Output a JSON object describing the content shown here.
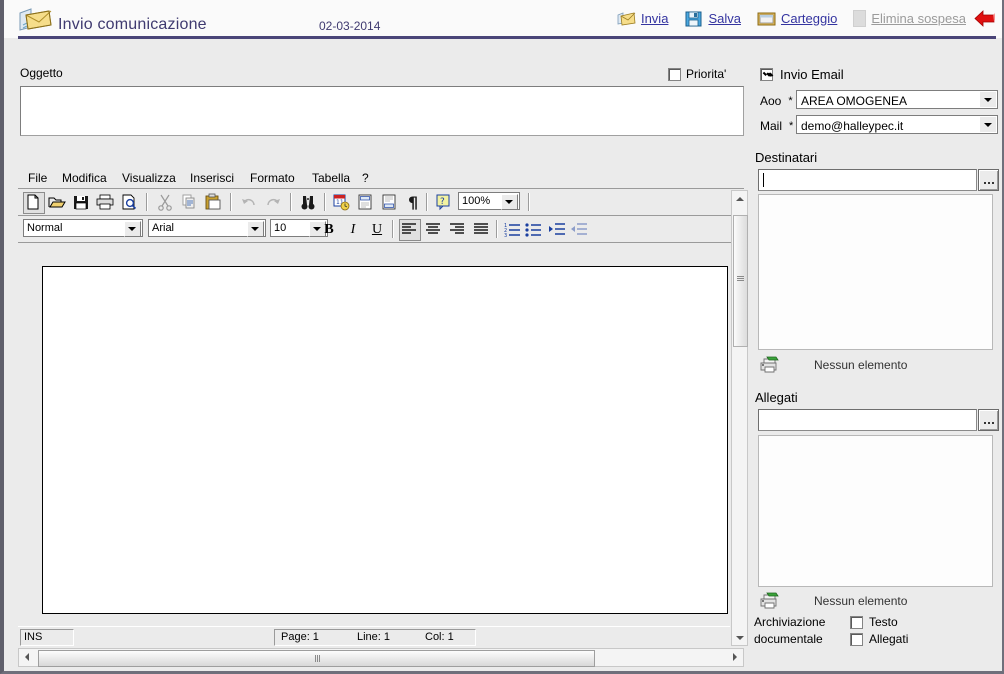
{
  "header": {
    "title": "Invio comunicazione",
    "date": "02-03-2014",
    "icon": "envelopes-icon",
    "actions": [
      {
        "label": "Invia",
        "icon": "send-mail-icon",
        "disabled": false
      },
      {
        "label": "Salva",
        "icon": "floppy-disk-icon",
        "disabled": false
      },
      {
        "label": "Carteggio",
        "icon": "folder-window-icon",
        "disabled": false
      },
      {
        "label": "Elimina sospesa",
        "icon": "delete-icon",
        "disabled": true
      }
    ],
    "back_icon": "red-back-arrow-icon"
  },
  "subject": {
    "label": "Oggetto",
    "value": "",
    "priority_label": "Priorita'",
    "priority_checked": false
  },
  "editor": {
    "menu": [
      "File",
      "Modifica",
      "Visualizza",
      "Inserisci",
      "Formato",
      "Tabella",
      "?"
    ],
    "toolbar1": [
      {
        "name": "new-document-icon",
        "glyph": "new"
      },
      {
        "name": "open-folder-icon",
        "glyph": "open"
      },
      {
        "name": "save-floppy-icon",
        "glyph": "save"
      },
      {
        "name": "print-icon",
        "glyph": "print"
      },
      {
        "name": "print-preview-icon",
        "glyph": "preview"
      },
      {
        "name": "cut-scissors-icon",
        "glyph": "cut"
      },
      {
        "name": "copy-icon",
        "glyph": "copy"
      },
      {
        "name": "paste-clipboard-icon",
        "glyph": "paste"
      },
      {
        "name": "undo-icon",
        "glyph": "undo"
      },
      {
        "name": "redo-icon",
        "glyph": "redo"
      },
      {
        "name": "find-binoculars-icon",
        "glyph": "find"
      },
      {
        "name": "insert-date-icon",
        "glyph": "date"
      },
      {
        "name": "header-icon",
        "glyph": "header"
      },
      {
        "name": "footer-icon",
        "glyph": "footer"
      },
      {
        "name": "paragraph-marks-icon",
        "glyph": "pilcrow"
      },
      {
        "name": "help-icon",
        "glyph": "help"
      }
    ],
    "zoom_value": "100%",
    "style_value": "Normal",
    "font_value": "Arial",
    "size_value": "10",
    "format_buttons": [
      "B",
      "I",
      "U"
    ],
    "align_icons": [
      "align-left-icon",
      "align-center-icon",
      "align-right-icon",
      "align-justify-icon"
    ],
    "list_icons": [
      "numbered-list-icon",
      "bullet-list-icon",
      "increase-indent-icon",
      "decrease-indent-icon"
    ],
    "body_text": "",
    "status": {
      "mode": "INS",
      "page": "Page: 1",
      "line": "Line: 1",
      "col": "Col: 1"
    }
  },
  "right_panel": {
    "invio_email_label": "Invio Email",
    "invio_email_checked": true,
    "aoo": {
      "label": "Aoo",
      "required": "*",
      "value": "AREA OMOGENEA"
    },
    "mail": {
      "label": "Mail",
      "required": "*",
      "value": "demo@halleypec.it"
    },
    "destinatari": {
      "label": "Destinatari",
      "input_value": "",
      "browse_label": "...",
      "empty_text": "Nessun elemento",
      "empty_icon": "printer-green-icon"
    },
    "allegati": {
      "label": "Allegati",
      "input_value": "",
      "browse_label": "...",
      "empty_text": "Nessun elemento",
      "empty_icon": "printer-green-icon"
    },
    "archiviazione": {
      "label_line1": "Archiviazione",
      "label_line2": "documentale",
      "checkbox_testo": "Testo",
      "checkbox_testo_checked": false,
      "checkbox_allegati": "Allegati",
      "checkbox_allegati_checked": false
    }
  },
  "colors": {
    "title": "#3f3a70",
    "link": "#3434a0",
    "disabled": "#9b9b9b",
    "rule": "#4a4578",
    "bg": "#ebebeb"
  }
}
